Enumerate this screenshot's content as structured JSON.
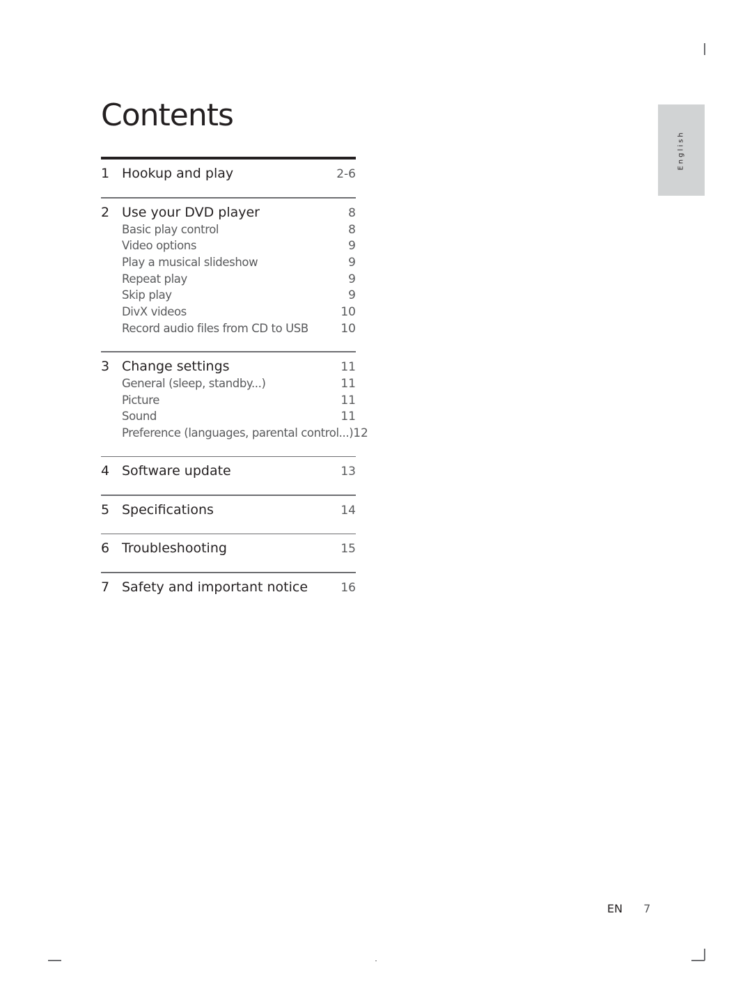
{
  "page": {
    "title": "Contents",
    "side_tab": "English",
    "footer": {
      "lang": "EN",
      "page_number": "7"
    }
  },
  "toc": [
    {
      "number": "1",
      "title": "Hookup and play",
      "page": "2-6",
      "subsections": []
    },
    {
      "number": "2",
      "title": "Use your DVD player",
      "page": "8",
      "subsections": [
        {
          "title": "Basic play control",
          "page": "8"
        },
        {
          "title": "Video options",
          "page": "9"
        },
        {
          "title": "Play a musical slideshow",
          "page": "9"
        },
        {
          "title": "Repeat play",
          "page": "9"
        },
        {
          "title": "Skip play",
          "page": "9"
        },
        {
          "title": "DivX videos",
          "page": "10"
        },
        {
          "title": "Record audio files from CD to USB",
          "page": "10"
        }
      ]
    },
    {
      "number": "3",
      "title": "Change settings",
      "page": "11",
      "subsections": [
        {
          "title": "General (sleep, standby...)",
          "page": "11"
        },
        {
          "title": "Picture",
          "page": "11"
        },
        {
          "title": "Sound",
          "page": "11"
        },
        {
          "title": "Preference (languages, parental control...)",
          "page": "12"
        }
      ]
    },
    {
      "number": "4",
      "title": "Software update",
      "page": "13",
      "subsections": []
    },
    {
      "number": "5",
      "title": "Specifications",
      "page": "14",
      "subsections": []
    },
    {
      "number": "6",
      "title": "Troubleshooting",
      "page": "15",
      "subsections": []
    },
    {
      "number": "7",
      "title": "Safety and important notice",
      "page": "16",
      "subsections": []
    }
  ]
}
